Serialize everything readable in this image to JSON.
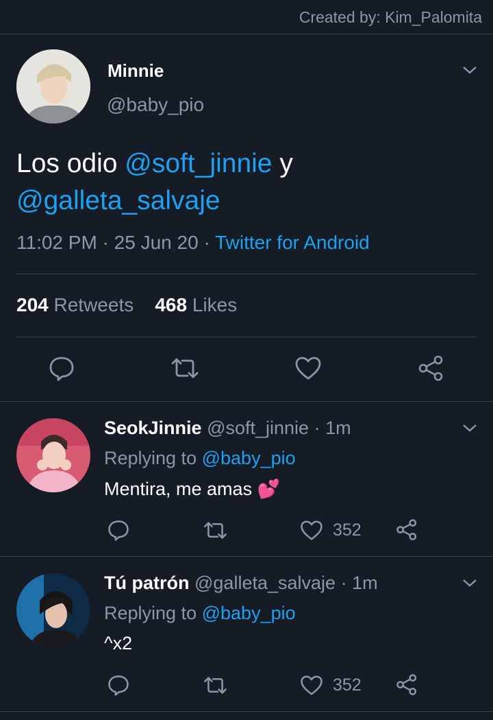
{
  "credit": "Created by: Kim_Palomita",
  "main_tweet": {
    "display_name": "Minnie",
    "handle": "@baby_pio",
    "text_prefix": "Los odio ",
    "mention1": "@soft_jinnie",
    "text_middle": " y",
    "mention2": "@galleta_salvaje",
    "time": "11:02 PM",
    "date": "25 Jun 20",
    "source": "Twitter for Android",
    "retweets_count": "204",
    "retweets_label": "Retweets",
    "likes_count": "468",
    "likes_label": "Likes",
    "icons": [
      "reply-icon",
      "retweet-icon",
      "like-icon",
      "share-icon"
    ]
  },
  "replies": [
    {
      "display_name": "SeokJinnie",
      "handle": "@soft_jinnie",
      "time": "1m",
      "replying_prefix": "Replying to",
      "replying_to": "@baby_pio",
      "text": "Mentira, me amas",
      "emoji": "💕",
      "likes": "352",
      "avatar_color": "#e889a8"
    },
    {
      "display_name": "Tú patrón",
      "handle": "@galleta_salvaje",
      "time": "1m",
      "replying_prefix": "Replying to",
      "replying_to": "@baby_pio",
      "text": "^x2",
      "likes": "352",
      "avatar_color": "#1a2a3e"
    }
  ],
  "colors": {
    "background": "#151c26",
    "link": "#1da1f2",
    "muted": "#8a98a6",
    "divider": "#3a4450"
  }
}
